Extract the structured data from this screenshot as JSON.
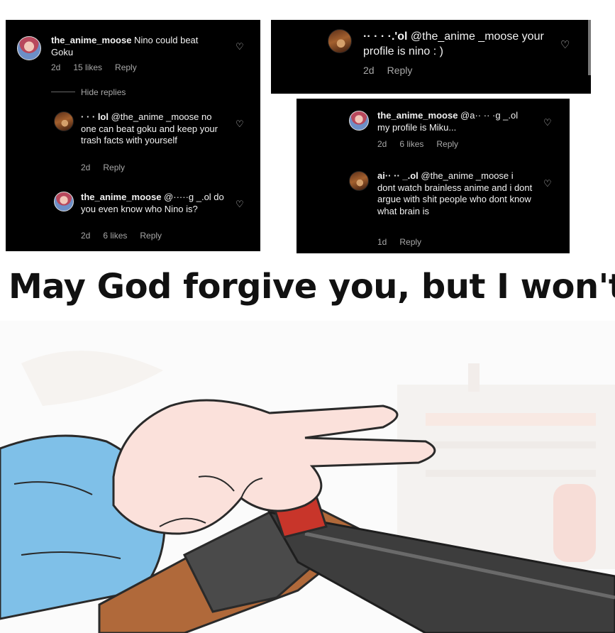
{
  "panel_a": {
    "comment1": {
      "user": "the_anime_moose",
      "text": " Nino could beat Goku",
      "age": "2d",
      "likes": "15 likes",
      "reply": "Reply"
    },
    "hide_replies": "Hide replies",
    "comment2": {
      "user": "· ·  · lol",
      "text": " @the_anime _moose  no one can beat goku and keep your trash facts with yourself",
      "age": "2d",
      "reply": "Reply"
    },
    "comment3": {
      "user": "the_anime_moose",
      "text": " @·····g _.ol do you even know who Nino is?",
      "age": "2d",
      "likes": "6 likes",
      "reply": "Reply"
    }
  },
  "panel_b": {
    "comment": {
      "user": "·· ·  · ·.'ol",
      "text": " @the_anime _moose  your profile is nino : )",
      "age": "2d",
      "reply": "Reply"
    }
  },
  "panel_c": {
    "comment1": {
      "user": "the_anime_moose",
      "text": " @a·· ·· ·g _.ol my profile is Miku...",
      "age": "2d",
      "likes": "6 likes",
      "reply": "Reply"
    },
    "comment2": {
      "user": "ai·· ·· _.ol",
      "text": " @the_anime _moose  i dont watch brainless anime and i dont argue with shit people who dont know what brain is",
      "age": "1d",
      "reply": "Reply"
    }
  },
  "caption": "May God forgive you, but I won't",
  "icons": {
    "heart": "♡"
  },
  "colors": {
    "panel_bg": "#000000",
    "muted_text": "#a8a8a8",
    "caption_text": "#111111"
  }
}
